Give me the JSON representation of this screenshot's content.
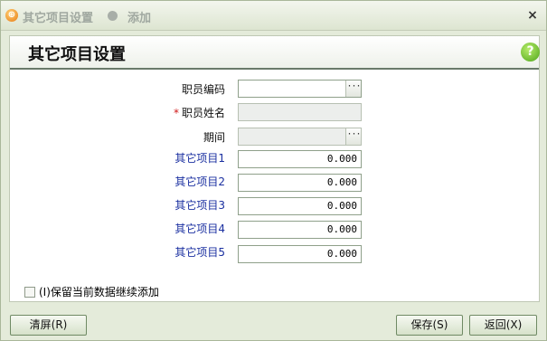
{
  "window": {
    "title": "其它项目设置",
    "mode": "添加",
    "close_glyph": "×"
  },
  "panel": {
    "title": "其它项目设置",
    "help_glyph": "?"
  },
  "form": {
    "employee_code_label": "职员编码",
    "employee_code_value": "",
    "employee_name_label": "职员姓名",
    "employee_name_required": "*",
    "employee_name_value": "",
    "period_label": "期间",
    "period_value": "",
    "lookup_glyph": "···",
    "items": [
      {
        "label": "其它项目1",
        "value": "0.000"
      },
      {
        "label": "其它项目2",
        "value": "0.000"
      },
      {
        "label": "其它项目3",
        "value": "0.000"
      },
      {
        "label": "其它项目4",
        "value": "0.000"
      },
      {
        "label": "其它项目5",
        "value": "0.000"
      }
    ],
    "keep_data_label": "(I)保留当前数据继续添加",
    "keep_data_checked": false
  },
  "buttons": {
    "clear": "清屏(R)",
    "save": "保存(S)",
    "back": "返回(X)"
  },
  "colors": {
    "item_label": "#1a2fa0",
    "required_star": "#d01818",
    "help_icon": "#4ea51a",
    "app_icon": "#e87a10"
  },
  "icons": {
    "app": "app-logo-icon",
    "help": "help-icon",
    "close": "close-icon",
    "lookup": "ellipsis-icon"
  }
}
